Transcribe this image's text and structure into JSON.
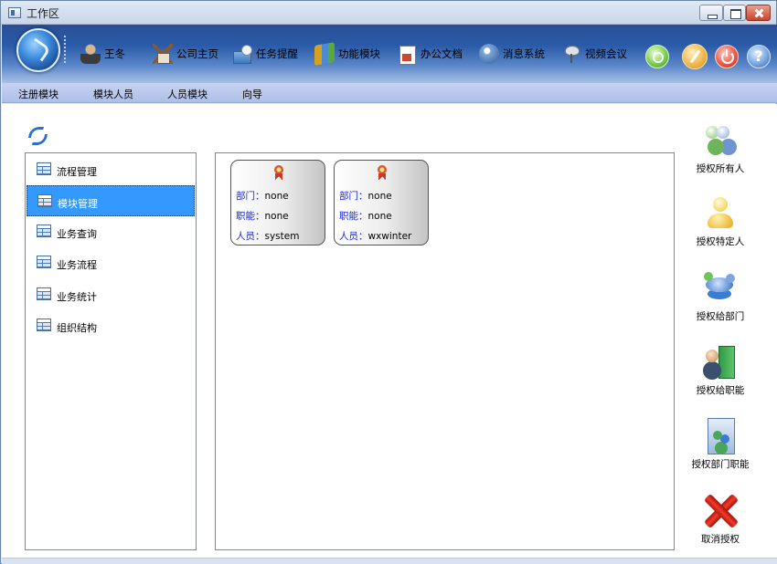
{
  "window": {
    "title": "工作区"
  },
  "toolbar": {
    "user_name": "王冬",
    "items": [
      {
        "label": "公司主页",
        "icon": "home-icon"
      },
      {
        "label": "任务提醒",
        "icon": "task-reminder-icon"
      },
      {
        "label": "功能模块",
        "icon": "function-module-icon"
      },
      {
        "label": "办公文档",
        "icon": "office-document-icon"
      },
      {
        "label": "消息系统",
        "icon": "message-system-icon"
      },
      {
        "label": "视频会议",
        "icon": "video-conference-icon"
      }
    ],
    "round_buttons": [
      "search-icon",
      "theme-icon",
      "power-icon",
      "help-icon"
    ],
    "help_glyph": "?"
  },
  "menu": {
    "items": [
      "注册模块",
      "模块人员",
      "人员模块",
      "向导"
    ]
  },
  "left_list": {
    "items": [
      {
        "label": "流程管理",
        "selected": false
      },
      {
        "label": "模块管理",
        "selected": true
      },
      {
        "label": "业务查询",
        "selected": false
      },
      {
        "label": "业务流程",
        "selected": false
      },
      {
        "label": "业务统计",
        "selected": false
      },
      {
        "label": "组织结构",
        "selected": false
      }
    ]
  },
  "cards": [
    {
      "dept_label": "部门：",
      "dept": "none",
      "role_label": "职能：",
      "role": "none",
      "person_label": "人员：",
      "person": "system"
    },
    {
      "dept_label": "部门：",
      "dept": "none",
      "role_label": "职能：",
      "role": "none",
      "person_label": "人员：",
      "person": "wxwinter"
    }
  ],
  "actions": [
    {
      "label": "授权所有人",
      "icon": "all-people-icon"
    },
    {
      "label": "授权特定人",
      "icon": "specific-person-icon"
    },
    {
      "label": "授权给部门",
      "icon": "department-icon"
    },
    {
      "label": "授权给职能",
      "icon": "role-icon"
    },
    {
      "label": "授权部门职能",
      "icon": "department-role-icon"
    },
    {
      "label": "取消授权",
      "icon": "cancel-icon"
    }
  ],
  "colors": {
    "selected_row": "#3399ff",
    "card_key_text": "#1a28d6",
    "menubar": "#b8c7ec",
    "toolbar_top": "#2c4f96"
  }
}
